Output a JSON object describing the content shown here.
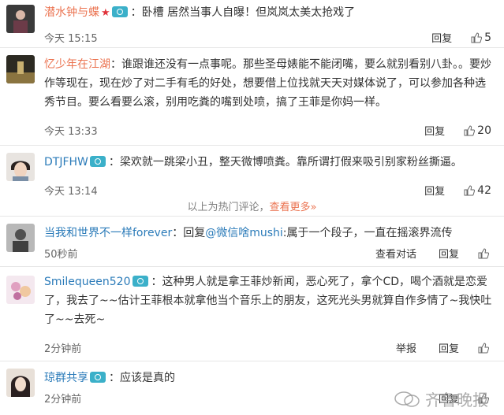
{
  "comments": [
    {
      "username": "潜水钟与蝶",
      "text": "卧槽 居然当事人自曝！但岚岚太美太抢戏了",
      "time": "今天 15:15",
      "actions": [
        "回复"
      ],
      "likes": "5"
    },
    {
      "username": "忆少年在江湖",
      "text": "谁跟谁还没有一点事呢。那些圣母婊能不能闭嘴，要么就别看别八卦。。要炒作等现在，现在炒了对二手有毛的好处，想要借上位找就天天对媒体说了，可以参加各种选秀节目。要么看要么滚，别用吃粪的嘴到处喷，搞了王菲是你妈一样。",
      "time": "今天 13:33",
      "actions": [
        "回复"
      ],
      "likes": "20"
    },
    {
      "username": "DTJFHW",
      "text": "梁欢就一跳梁小丑，整天微博喷粪。靠所谓打假来吸引别家粉丝撕逼。",
      "time": "今天 13:14",
      "actions": [
        "回复"
      ],
      "likes": "42"
    },
    {
      "username": "当我和世界不一样forever",
      "reply_prefix": "回复",
      "reply_to": "@微信啥mushi",
      "text": "属于一个段子，一直在摇滚界流传",
      "time": "50秒前",
      "actions": [
        "查看对话",
        "回复"
      ],
      "likes": ""
    },
    {
      "username": "Smilequeen520",
      "text": "这种男人就是拿王菲炒新闻，恶心死了，拿个CD，喝个酒就是恋爱了，我去了~~估计王菲根本就拿他当个音乐上的朋友，这死光头男就算自作多情了~我快吐了~~去死~",
      "time": "2分钟前",
      "actions": [
        "举报",
        "回复"
      ],
      "likes": ""
    },
    {
      "username": "琼群共享",
      "text": "应该是真的",
      "time": "2分钟前",
      "actions": [
        "回复"
      ],
      "likes": ""
    }
  ],
  "hot_divider": {
    "text": "以上为热门评论，",
    "more": "查看更多»"
  },
  "watermark": "齐鲁晚报",
  "colors": {
    "username": "#eb7350",
    "link": "#2b7bb9",
    "text": "#333333",
    "meta": "#666666"
  }
}
